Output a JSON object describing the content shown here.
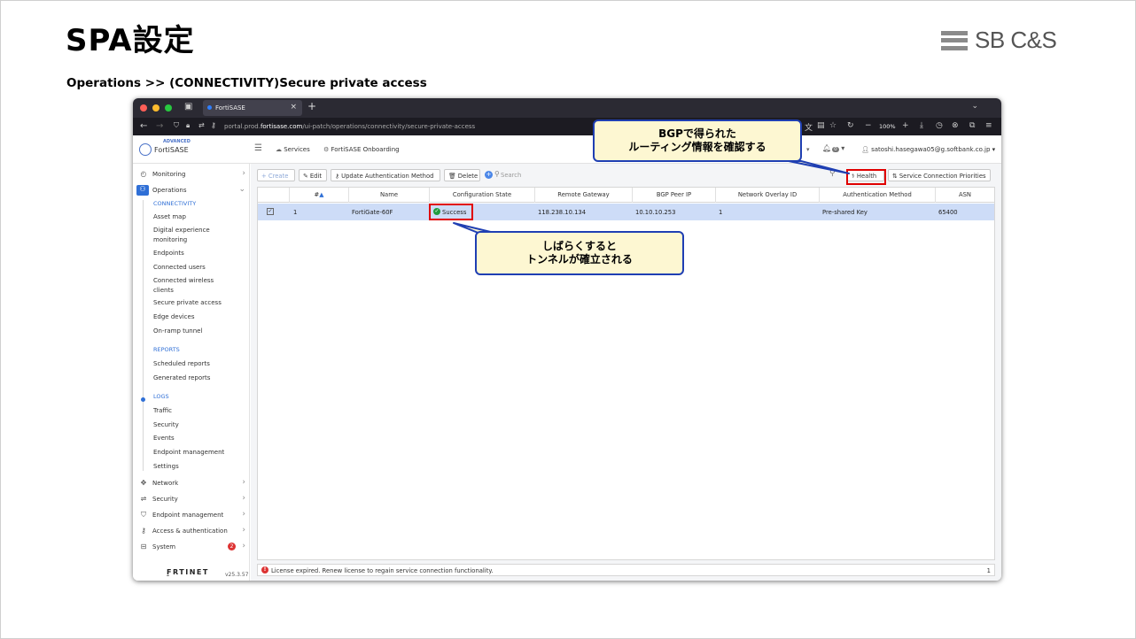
{
  "slide": {
    "title": "SPA設定",
    "subtitle": "Operations >> (CONNECTIVITY)Secure private access",
    "brand": "SB C&S"
  },
  "browser": {
    "tab_title": "FortiSASE",
    "url_prefix": "portal.prod.",
    "url_domain": "fortisase.com",
    "url_path": "/ui-patch/operations/connectivity/secure-private-access",
    "zoom": "100%"
  },
  "header": {
    "logo_badge": "ADVANCED",
    "logo_name": "FortiSASE",
    "services": "Services",
    "onboarding": "FortiSASE Onboarding",
    "notifications": "0",
    "user": "satoshi.hasegawa05@g.softbank.co.jp"
  },
  "sidebar": {
    "monitoring": "Monitoring",
    "operations": "Operations",
    "sections": {
      "connectivity": "CONNECTIVITY",
      "reports": "REPORTS",
      "logs": "LOGS"
    },
    "connectivity_items": [
      "Asset map",
      "Digital experience monitoring",
      "Endpoints",
      "Connected users",
      "Connected wireless clients",
      "Secure private access",
      "Edge devices",
      "On-ramp tunnel"
    ],
    "report_items": [
      "Scheduled reports",
      "Generated reports"
    ],
    "log_items": [
      "Traffic",
      "Security",
      "Events",
      "Endpoint management",
      "Settings"
    ],
    "bottom_items": [
      "Network",
      "Security",
      "Endpoint management",
      "Access & authentication",
      "System"
    ],
    "system_badge": "2",
    "footer_logo": "F̱RTINET",
    "version": "v25.3.57"
  },
  "toolbar": {
    "create": "Create",
    "edit": "Edit",
    "update_auth": "Update Authentication Method",
    "delete": "Delete",
    "search_placeholder": "Search",
    "health": "Health",
    "priorities": "Service Connection Priorities"
  },
  "table": {
    "columns": [
      "#",
      "Name",
      "Configuration State",
      "Remote Gateway",
      "BGP Peer IP",
      "Network Overlay ID",
      "Authentication Method",
      "ASN"
    ],
    "rows": [
      {
        "num": "1",
        "name": "FortiGate-60F",
        "state": "Success",
        "gateway": "118.238.10.134",
        "bgp_peer": "10.10.10.253",
        "overlay": "1",
        "auth": "Pre-shared Key",
        "asn": "65400"
      }
    ]
  },
  "status_bar": {
    "message": "License expired. Renew license to regain service connection functionality.",
    "count": "1"
  },
  "callouts": {
    "bgp": [
      "BGPで得られた",
      "ルーティング情報を確認する"
    ],
    "tunnel": [
      "しばらくすると",
      "トンネルが確立される"
    ]
  },
  "colors": {
    "accent": "#2f6fd6",
    "highlight": "#e00000",
    "callout_fill": "#fdf7d2",
    "callout_border": "#1f3fb3",
    "selected_row": "#cddcf7",
    "success": "#1e9c3e"
  }
}
